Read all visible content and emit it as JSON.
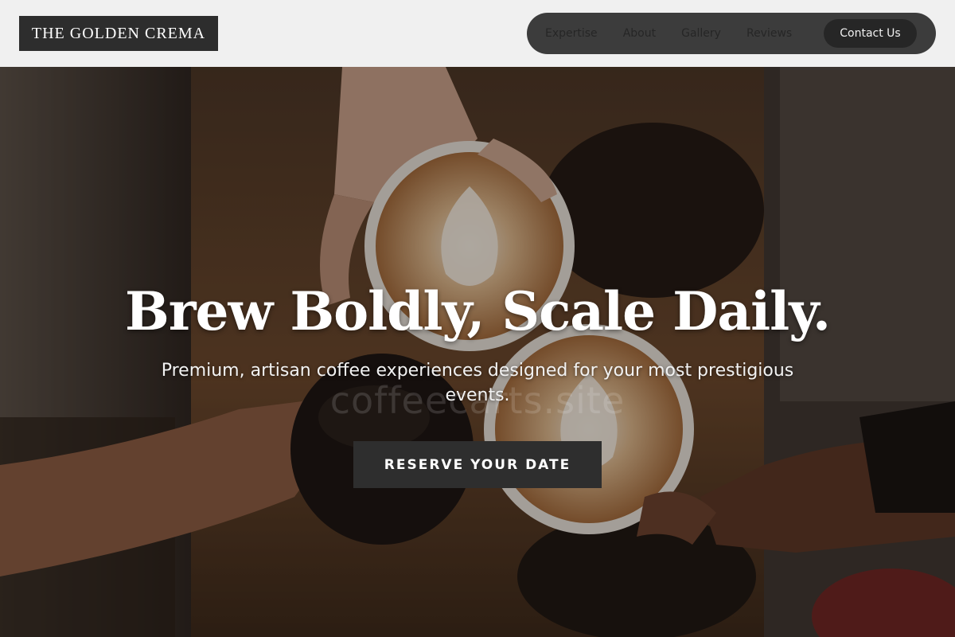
{
  "header": {
    "logo_text": "THE GOLDEN CREMA",
    "nav": [
      {
        "label": "Expertise"
      },
      {
        "label": "About"
      },
      {
        "label": "Gallery"
      },
      {
        "label": "Reviews"
      }
    ],
    "contact_label": "Contact Us"
  },
  "hero": {
    "title": "Brew Boldly, Scale Daily.",
    "subtitle": "Premium, artisan coffee experiences designed for your most prestigious events.",
    "watermark": "coffeecarts.site",
    "cta_label": "RESERVE YOUR DATE",
    "background_image": "hands-toasting-coffee-cups"
  },
  "colors": {
    "header_bg": "#f0f0f0",
    "logo_bg": "#2d2d2d",
    "nav_bg": "#3c3c3c",
    "button_bg": "#2e2e2e"
  }
}
